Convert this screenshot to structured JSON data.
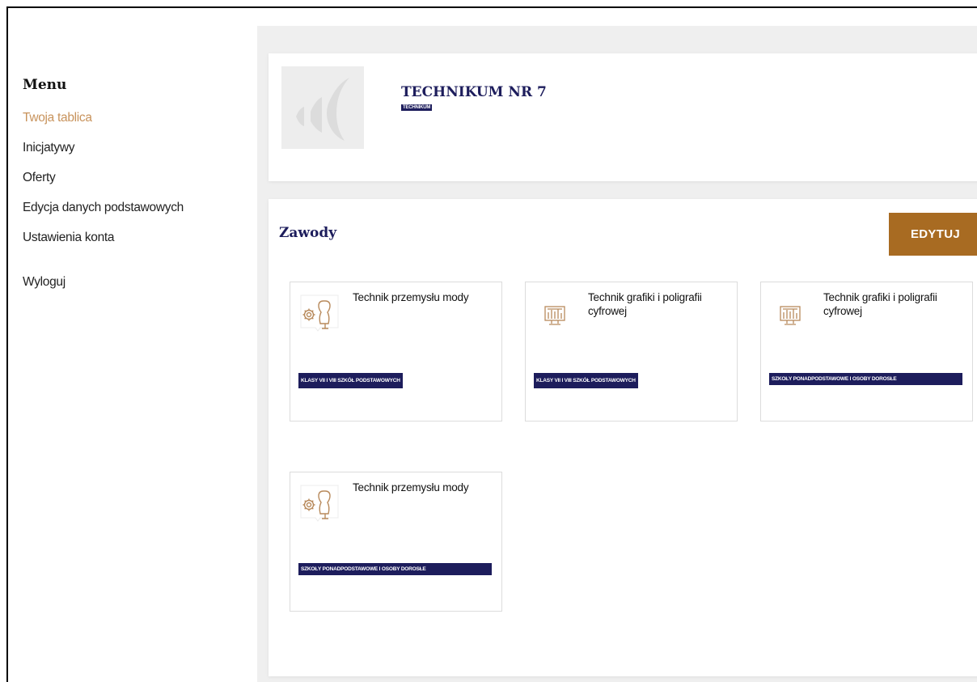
{
  "sidebar": {
    "title": "Menu",
    "items": [
      {
        "label": "Twoja tablica",
        "active": true
      },
      {
        "label": "Inicjatywy"
      },
      {
        "label": "Oferty"
      },
      {
        "label": "Edycja danych podstawowych"
      },
      {
        "label": "Ustawienia konta"
      }
    ],
    "logout": "Wyloguj"
  },
  "school": {
    "name": "TECHNIKUM NR 7",
    "type": "TECHNIKUM"
  },
  "jobs_section": {
    "title": "Zawody",
    "edit_label": "EDYTUJ",
    "jobs": [
      {
        "name": "Technik przemysłu mody",
        "category": "KLASY VII I VIII SZKÓŁ PODSTAWOWYCH",
        "icon": "fashion-mannequin-gear-icon"
      },
      {
        "name": "Technik grafiki i poligrafii cyfrowej",
        "category": "KLASY VII I VIII SZKÓŁ PODSTAWOWYCH",
        "icon": "graphics-monitor-icon"
      },
      {
        "name": "Technik grafiki i poligrafii cyfrowej",
        "category": "SZKOŁY PONADPODSTAWOWE I OSOBY DOROSŁE",
        "icon": "graphics-monitor-icon"
      },
      {
        "name": "Technik przemysłu mody",
        "category": "SZKOŁY PONADPODSTAWOWE I OSOBY DOROSŁE",
        "icon": "fashion-mannequin-gear-icon"
      }
    ]
  },
  "colors": {
    "navy": "#1d1d5c",
    "accent_orange": "#a86b22",
    "active_link": "#c8935c",
    "icon_stroke": "#b88a5c"
  }
}
